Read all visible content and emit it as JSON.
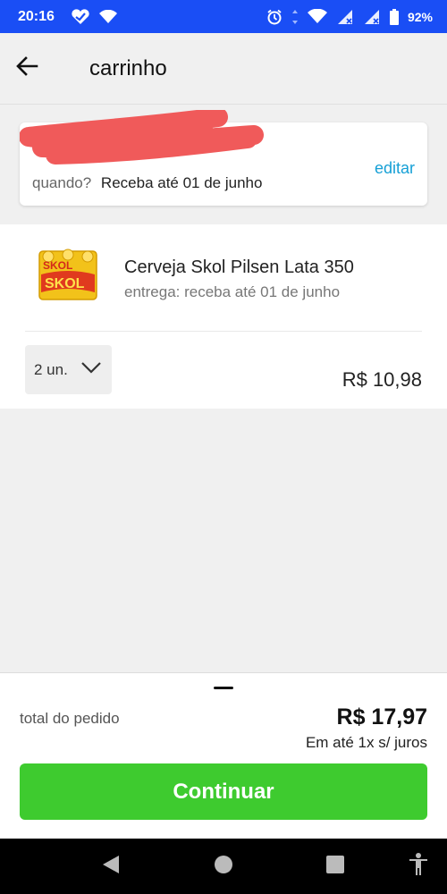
{
  "status_bar": {
    "time": "20:16",
    "battery": "92%",
    "icons": [
      "heart-app-icon",
      "wifi-icon",
      "alarm-icon",
      "data-arrows-icon",
      "wifi-icon",
      "signal-icon",
      "signal-icon",
      "battery-icon"
    ]
  },
  "header": {
    "title": "carrinho",
    "back_icon": "arrow-left-icon"
  },
  "delivery": {
    "edit_label": "editar",
    "when_label": "quando?",
    "when_value": "Receba até 01 de junho"
  },
  "product": {
    "name": "Cerveja Skol Pilsen Lata 350",
    "delivery": "entrega: receba até 01 de junho",
    "quantity": "2 un.",
    "price": "R$ 10,98",
    "image_brand_text": "SKOL"
  },
  "summary": {
    "total_label": "total do pedido",
    "total_value": "R$ 17,97",
    "installments": "Em até 1x s/ juros",
    "continue_label": "Continuar"
  },
  "colors": {
    "status_bar": "#1a4ef5",
    "link": "#16a0d6",
    "primary_button": "#3ecb2f",
    "redaction": "#f05a5a"
  }
}
